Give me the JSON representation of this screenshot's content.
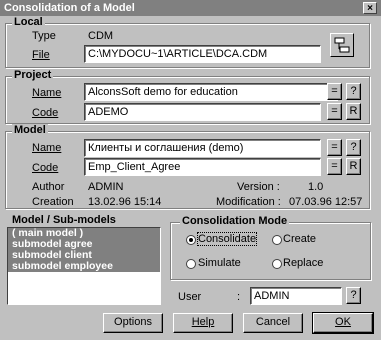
{
  "window": {
    "title": "Consolidation of a Model",
    "close_glyph": "×"
  },
  "local": {
    "group_title": "Local",
    "type_label": "Type",
    "type_value": "CDM",
    "file_label": "File",
    "file_value": "C:\\MYDOCU~1\\ARTICLE\\DCA.CDM"
  },
  "project": {
    "group_title": "Project",
    "name_label": "Name",
    "name_value": "AlconsSoft demo for education",
    "code_label": "Code",
    "code_value": "ADEMO",
    "eq_label": "=",
    "help_label": "?",
    "r_label": "R"
  },
  "model": {
    "group_title": "Model",
    "name_label": "Name",
    "name_value": "Клиенты и соглашения (demo)",
    "code_label": "Code",
    "code_value": "Emp_Client_Agree",
    "eq_label": "=",
    "help_label": "?",
    "r_label": "R",
    "author_label": "Author",
    "author_value": "ADMIN",
    "version_label": "Version :",
    "version_value": "1.0",
    "creation_label": "Creation",
    "creation_value": "13.02.96 15:14",
    "modification_label": "Modification :",
    "modification_value": "07.03.96 12:57"
  },
  "submodels": {
    "title": "Model / Sub-models",
    "items": [
      "( main model )",
      "submodel agree",
      "submodel client",
      "submodel employee"
    ]
  },
  "consolidation_mode": {
    "group_title": "Consolidation Mode",
    "options": {
      "consolidate": "Consolidate",
      "create": "Create",
      "simulate": "Simulate",
      "replace": "Replace"
    },
    "selected": "Consolidate"
  },
  "user": {
    "label": "User",
    "colon": ":",
    "value": "ADMIN",
    "help_label": "?"
  },
  "buttons": {
    "options": "Options",
    "help": "Help",
    "cancel": "Cancel",
    "ok": "OK"
  }
}
